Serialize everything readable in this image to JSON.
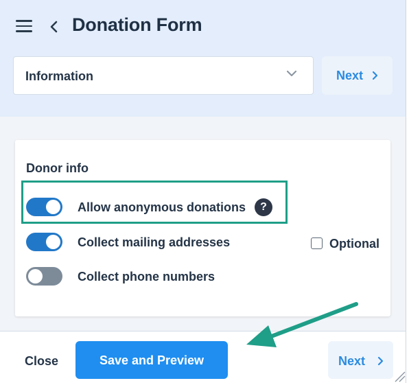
{
  "header": {
    "title": "Donation Form",
    "menu_icon": "hamburger-menu-icon",
    "back_icon": "chevron-left-icon",
    "background": "#e3edfb"
  },
  "step_select": {
    "selected": "Information",
    "chevron_icon": "chevron-down-icon"
  },
  "top_next": {
    "label": "Next",
    "icon": "chevron-right-icon"
  },
  "card": {
    "section_title": "Donor info",
    "options": [
      {
        "label": "Allow anonymous donations",
        "enabled": true,
        "help_icon": "question-circle-icon",
        "help_glyph": "?"
      },
      {
        "label": "Collect mailing addresses",
        "enabled": true
      },
      {
        "label": "Collect phone numbers",
        "enabled": false
      }
    ],
    "optional": {
      "label": "Optional",
      "checked": false
    }
  },
  "footer": {
    "close_label": "Close",
    "save_label": "Save and Preview",
    "next_label": "Next"
  },
  "colors": {
    "accent": "#1f8ef0",
    "toggle_on": "#2278c8",
    "toggle_off": "#7d8b99",
    "highlight": "#1f9e88",
    "annotation_arrow": "#1f9e88"
  }
}
